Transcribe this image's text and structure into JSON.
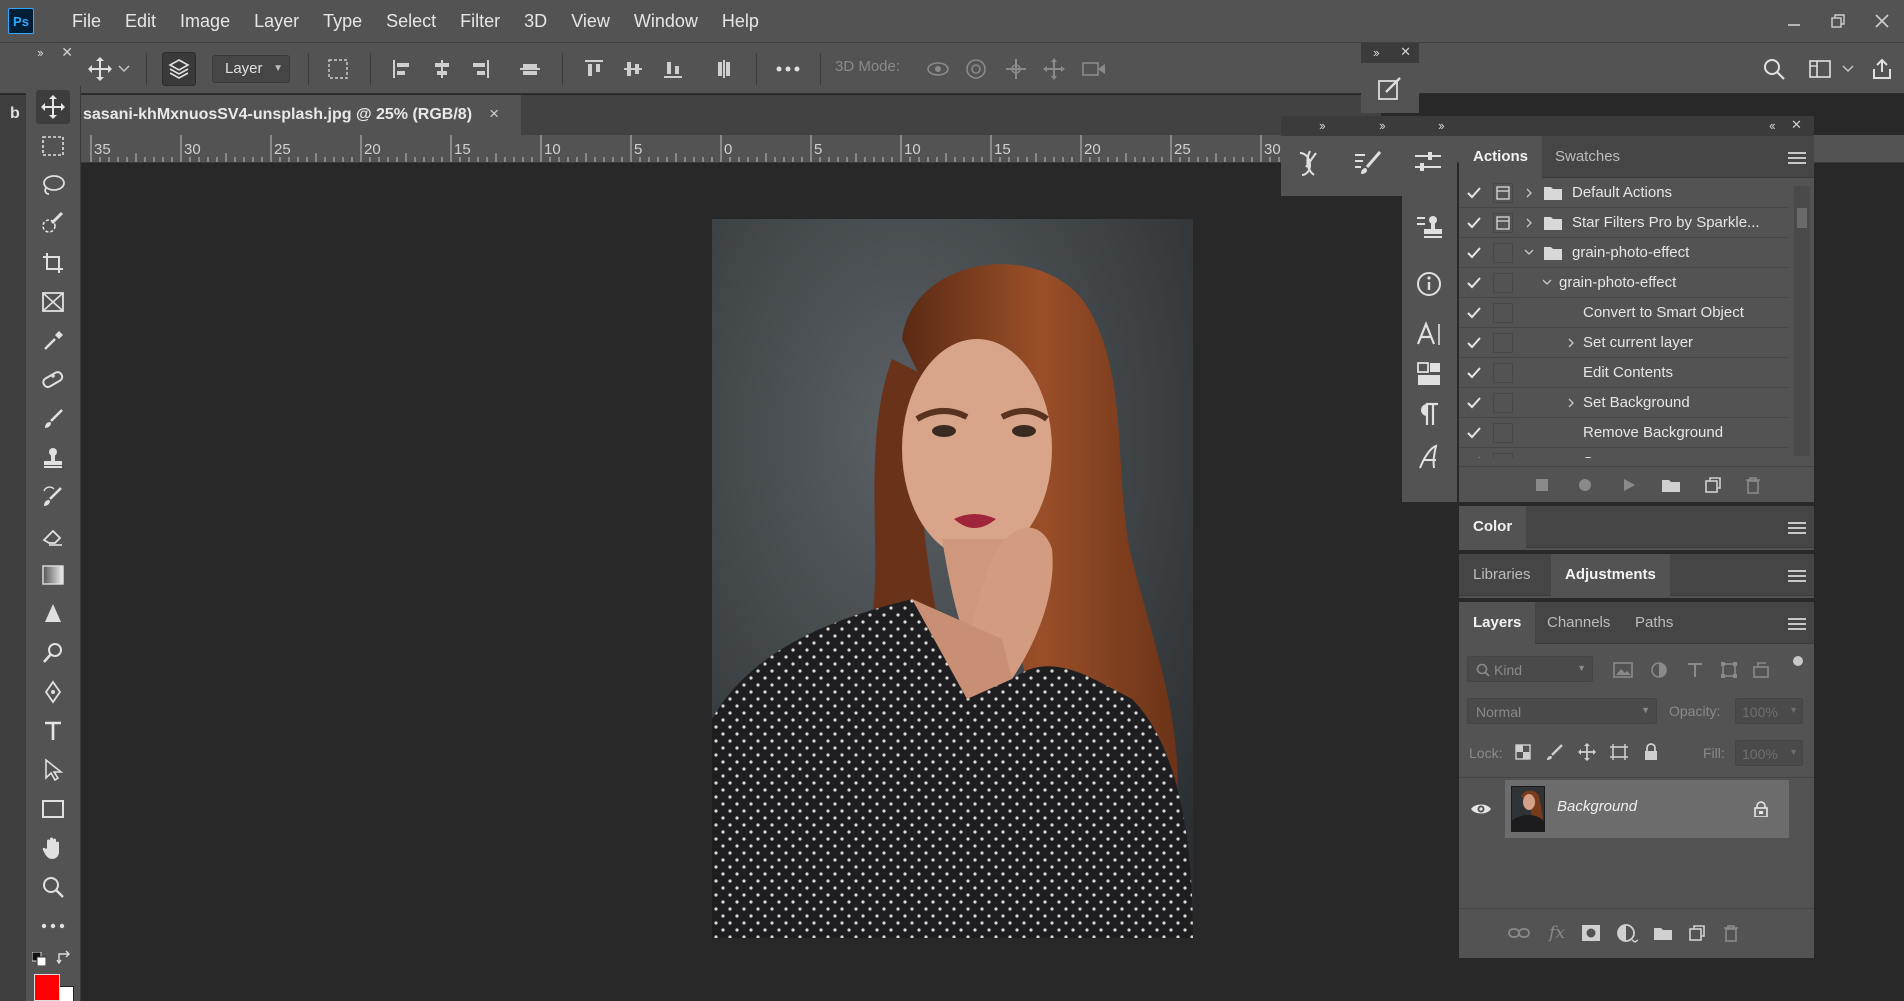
{
  "app": {
    "logo_text": "Ps",
    "menu": [
      "File",
      "Edit",
      "Image",
      "Layer",
      "Type",
      "Select",
      "Filter",
      "3D",
      "View",
      "Window",
      "Help"
    ]
  },
  "options_bar": {
    "layer_select_value": "Layer",
    "mode_3d_label": "3D Mode:"
  },
  "document": {
    "tab_title": "sasani-khMxnuosSV4-unsplash.jpg @ 25% (RGB/8)",
    "left_tab_fragment": "b",
    "tab_close": "×"
  },
  "ruler": {
    "labels": [
      "35",
      "30",
      "25",
      "20",
      "15",
      "10",
      "5",
      "0",
      "5",
      "10",
      "15",
      "20",
      "25",
      "30"
    ]
  },
  "actions_panel": {
    "tabs": [
      "Actions",
      "Swatches"
    ],
    "rows": [
      {
        "label": "Default Actions",
        "indent": 1,
        "expanded": false,
        "folder": true,
        "dialog": true
      },
      {
        "label": "Star Filters Pro by Sparkle...",
        "indent": 1,
        "expanded": false,
        "folder": true,
        "dialog": true
      },
      {
        "label": "grain-photo-effect",
        "indent": 1,
        "expanded": true,
        "folder": true,
        "dialog": false
      },
      {
        "label": "grain-photo-effect",
        "indent": 2,
        "expanded": true,
        "folder": false,
        "dialog": false
      },
      {
        "label": "Convert to Smart Object",
        "indent": 3,
        "expanded": null,
        "folder": false,
        "dialog": false
      },
      {
        "label": "Set current layer",
        "indent": 3,
        "expanded": false,
        "folder": false,
        "dialog": false
      },
      {
        "label": "Edit Contents",
        "indent": 3,
        "expanded": null,
        "folder": false,
        "dialog": false
      },
      {
        "label": "Set Background",
        "indent": 3,
        "expanded": false,
        "folder": false,
        "dialog": false
      },
      {
        "label": "Remove Background",
        "indent": 3,
        "expanded": null,
        "folder": false,
        "dialog": false
      },
      {
        "label": "Save",
        "indent": 3,
        "expanded": null,
        "folder": false,
        "dialog": false
      }
    ]
  },
  "color_panel": {
    "tab": "Color"
  },
  "libraries_panel": {
    "tabs": [
      "Libraries",
      "Adjustments"
    ]
  },
  "layers_panel": {
    "tabs": [
      "Layers",
      "Channels",
      "Paths"
    ],
    "filter_placeholder": "Kind",
    "blend_mode": "Normal",
    "opacity_label": "Opacity:",
    "opacity_value": "100%",
    "lock_label": "Lock:",
    "fill_label": "Fill:",
    "fill_value": "100%",
    "layers": [
      {
        "name": "Background",
        "visible": true,
        "locked": true
      }
    ]
  },
  "colors": {
    "foreground": "#ff0000",
    "background": "#ffffff",
    "accent": "#31a8ff"
  }
}
